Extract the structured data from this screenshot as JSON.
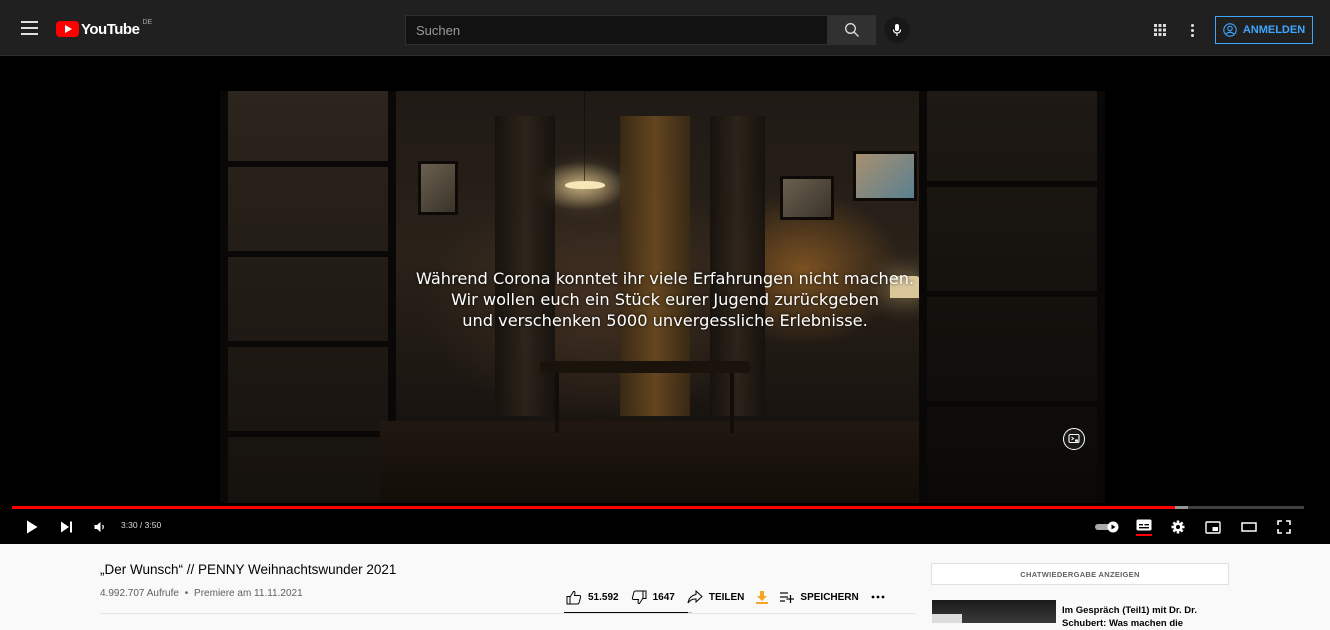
{
  "header": {
    "logo_text": "YouTube",
    "country_code": "DE",
    "search_placeholder": "Suchen",
    "signin_label": "ANMELDEN"
  },
  "player": {
    "subtitles": [
      "Während Corona konntet ihr viele Erfahrungen nicht machen.",
      "Wir wollen euch ein Stück eurer Jugend zurückgeben",
      "und verschenken 5000 unvergessliche Erlebnisse."
    ],
    "time_display": "3:30 / 3:50",
    "progress": 0.9,
    "buffer": 0.91
  },
  "video": {
    "title": "„Der Wunsch“ // PENNY Weihnachtswunder 2021",
    "views": "4.992.707 Aufrufe",
    "separator": "•",
    "premiere": "Premiere am 11.11.2021",
    "likes": "51.592",
    "dislikes": "1647",
    "like_ratio": 0.97,
    "share_label": "TEILEN",
    "save_label": "SPEICHERN"
  },
  "sidebar": {
    "chat_replay_label": "CHATWIEDERGABE ANZEIGEN",
    "recommendation_title": "Im Gespräch (Teil1) mit Dr. Dr. Schubert: Was machen die"
  },
  "colors": {
    "brand_red": "#ff0000",
    "accent_blue": "#3ea6ff",
    "topbar": "#202020",
    "download_orange": "#f5a623"
  }
}
